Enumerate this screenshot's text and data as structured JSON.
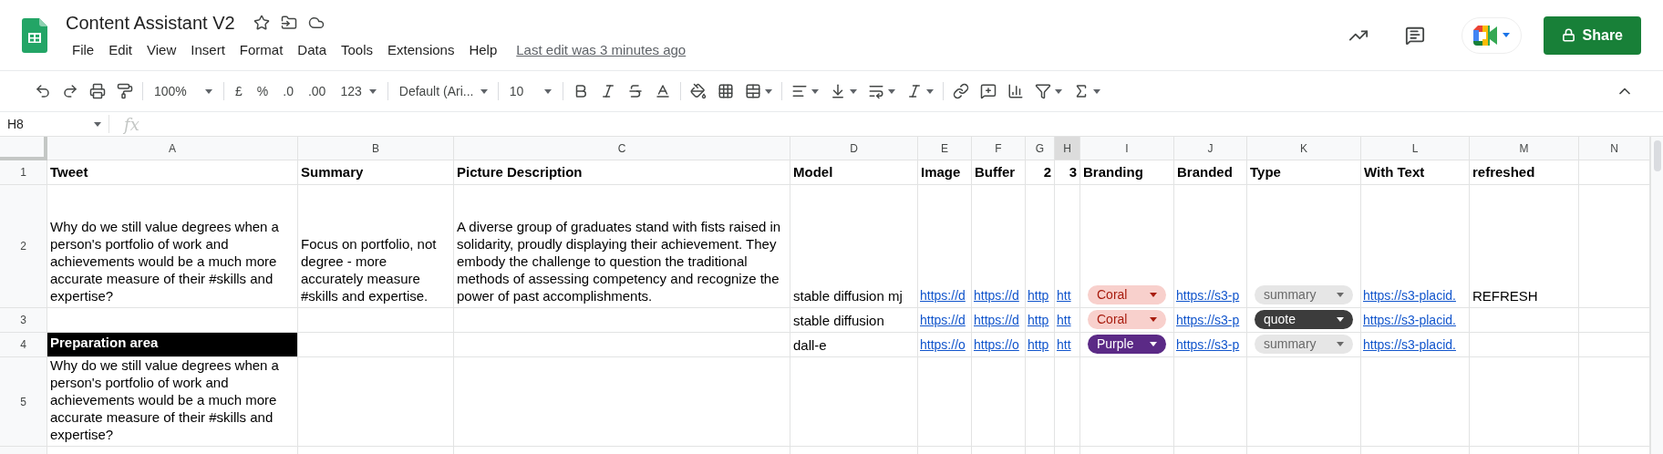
{
  "document": {
    "title": "Content Assistant V2",
    "last_edit": "Last edit was 3 minutes ago"
  },
  "menu": [
    "File",
    "Edit",
    "View",
    "Insert",
    "Format",
    "Data",
    "Tools",
    "Extensions",
    "Help"
  ],
  "share_button": {
    "label": "Share"
  },
  "toolbar": {
    "zoom": "100%",
    "currency": "£",
    "percent": "%",
    "decrease_decimals": ".0",
    "increase_decimals": ".00",
    "number_format": "123",
    "font": "Default (Ari...",
    "font_size": "10"
  },
  "formula_bar": {
    "cell_ref": "H8",
    "fx": "fx"
  },
  "columns": [
    {
      "label": "A",
      "selected": false
    },
    {
      "label": "B",
      "selected": false
    },
    {
      "label": "C",
      "selected": false
    },
    {
      "label": "D",
      "selected": false
    },
    {
      "label": "E",
      "selected": false
    },
    {
      "label": "F",
      "selected": false
    },
    {
      "label": "G",
      "selected": false
    },
    {
      "label": "H",
      "selected": true
    },
    {
      "label": "I",
      "selected": false
    },
    {
      "label": "J",
      "selected": false
    },
    {
      "label": "K",
      "selected": false
    },
    {
      "label": "L",
      "selected": false
    },
    {
      "label": "M",
      "selected": false
    },
    {
      "label": "N",
      "selected": false
    }
  ],
  "rows": [
    {
      "number": "1",
      "cells": [
        {
          "kind": "header",
          "text": "Tweet"
        },
        {
          "kind": "header",
          "text": "Summary"
        },
        {
          "kind": "header",
          "text": "Picture Description"
        },
        {
          "kind": "header",
          "text": "Model"
        },
        {
          "kind": "header",
          "text": "Image"
        },
        {
          "kind": "header",
          "text": "Buffer"
        },
        {
          "kind": "number_header",
          "text": "2"
        },
        {
          "kind": "number_header",
          "text": "3"
        },
        {
          "kind": "header",
          "text": "Branding"
        },
        {
          "kind": "header",
          "text": "Branded"
        },
        {
          "kind": "header",
          "text": "Type"
        },
        {
          "kind": "header",
          "text": "With Text"
        },
        {
          "kind": "header",
          "text": "refreshed"
        },
        {
          "kind": "empty"
        }
      ]
    },
    {
      "number": "2",
      "cells": [
        {
          "kind": "text",
          "text": "Why do we still value degrees when a person's portfolio of work and achievements would be a much more accurate measure of their #skills and expertise?"
        },
        {
          "kind": "text",
          "text": "Focus on portfolio, not degree - more accurately measure #skills and expertise."
        },
        {
          "kind": "text",
          "text": "A diverse group of graduates stand with fists raised in solidarity, proudly displaying their achievement. They embody the challenge to question the traditional methods of assessing competency and recognize the power of past accomplishments."
        },
        {
          "kind": "text",
          "text": "stable diffusion mj"
        },
        {
          "kind": "link",
          "text": "https://d"
        },
        {
          "kind": "link",
          "text": "https://d"
        },
        {
          "kind": "link",
          "text": "http"
        },
        {
          "kind": "link",
          "text": "htt"
        },
        {
          "kind": "chip",
          "text": "Coral",
          "color": "#f8d0cc"
        },
        {
          "kind": "link",
          "text": "https://s3-p"
        },
        {
          "kind": "chip",
          "text": "summary",
          "color": "#e6e6e6"
        },
        {
          "kind": "link",
          "text": "https://s3-placid."
        },
        {
          "kind": "text",
          "text": "REFRESH"
        },
        {
          "kind": "empty"
        }
      ]
    },
    {
      "number": "3",
      "cells": [
        {
          "kind": "empty"
        },
        {
          "kind": "empty"
        },
        {
          "kind": "empty"
        },
        {
          "kind": "text",
          "text": "stable diffusion"
        },
        {
          "kind": "link",
          "text": "https://d"
        },
        {
          "kind": "link",
          "text": "https://d"
        },
        {
          "kind": "link",
          "text": "http"
        },
        {
          "kind": "link",
          "text": "htt"
        },
        {
          "kind": "chip",
          "text": "Coral",
          "color": "#f8d0cc"
        },
        {
          "kind": "link",
          "text": "https://s3-p"
        },
        {
          "kind": "chip",
          "text": "quote",
          "color": "#3c3c3c"
        },
        {
          "kind": "link",
          "text": "https://s3-placid."
        },
        {
          "kind": "empty"
        },
        {
          "kind": "empty"
        }
      ]
    },
    {
      "number": "4",
      "cells": [
        {
          "kind": "banner",
          "text": "Preparation area"
        },
        {
          "kind": "empty"
        },
        {
          "kind": "empty"
        },
        {
          "kind": "text",
          "text": "dall-e"
        },
        {
          "kind": "link",
          "text": "https://o"
        },
        {
          "kind": "link",
          "text": "https://o"
        },
        {
          "kind": "link",
          "text": "http"
        },
        {
          "kind": "link",
          "text": "htt"
        },
        {
          "kind": "chip",
          "text": "Purple",
          "color": "#5b2a86"
        },
        {
          "kind": "link",
          "text": "https://s3-p"
        },
        {
          "kind": "chip",
          "text": "summary",
          "color": "#e6e6e6"
        },
        {
          "kind": "link",
          "text": "https://s3-placid."
        },
        {
          "kind": "empty"
        },
        {
          "kind": "empty"
        }
      ]
    },
    {
      "number": "5",
      "cells": [
        {
          "kind": "text",
          "text": "Why do we still value degrees when a person's portfolio of work and achievements would be a much more accurate measure of their #skills and expertise?"
        },
        {
          "kind": "empty"
        },
        {
          "kind": "empty"
        },
        {
          "kind": "empty"
        },
        {
          "kind": "empty"
        },
        {
          "kind": "empty"
        },
        {
          "kind": "empty"
        },
        {
          "kind": "empty"
        },
        {
          "kind": "empty"
        },
        {
          "kind": "empty"
        },
        {
          "kind": "empty"
        },
        {
          "kind": "empty"
        },
        {
          "kind": "empty"
        },
        {
          "kind": "empty"
        }
      ]
    }
  ]
}
